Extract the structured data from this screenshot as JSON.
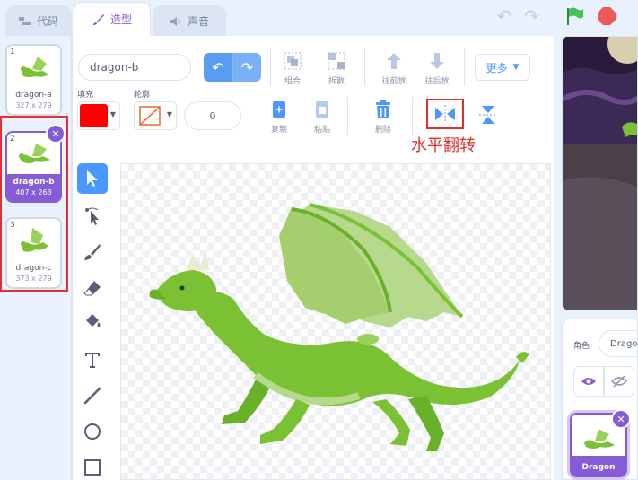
{
  "tabs": [
    {
      "label": "代码",
      "icon": "code-icon"
    },
    {
      "label": "造型",
      "icon": "paintbrush-icon"
    },
    {
      "label": "声音",
      "icon": "speaker-icon"
    }
  ],
  "costumes": [
    {
      "number": "1",
      "name": "dragon-a",
      "size": "327 x 279"
    },
    {
      "number": "2",
      "name": "dragon-b",
      "size": "407 x 263"
    },
    {
      "number": "3",
      "name": "dragon-c",
      "size": "373 x 279"
    }
  ],
  "editor": {
    "costume_name": "dragon-b",
    "fill_label": "填充",
    "outline_label": "轮廓",
    "outline_width": "0",
    "fill_color": "#ff0000",
    "outline_color": "#e8662e",
    "tools": {
      "group": "组合",
      "ungroup": "拆散",
      "forward": "往前放",
      "backward": "往后放",
      "copy": "复制",
      "paste": "粘贴",
      "delete": "删除"
    },
    "more_label": "更多",
    "callout": "水平翻转"
  },
  "sprite_info": {
    "label": "角色",
    "name_value": "Dragon",
    "sprite_name": "Dragon"
  },
  "colors": {
    "accent": "#855cd6",
    "blue": "#4c97ff",
    "highlight": "#e0312f",
    "dragon_green": "#7ac133"
  }
}
